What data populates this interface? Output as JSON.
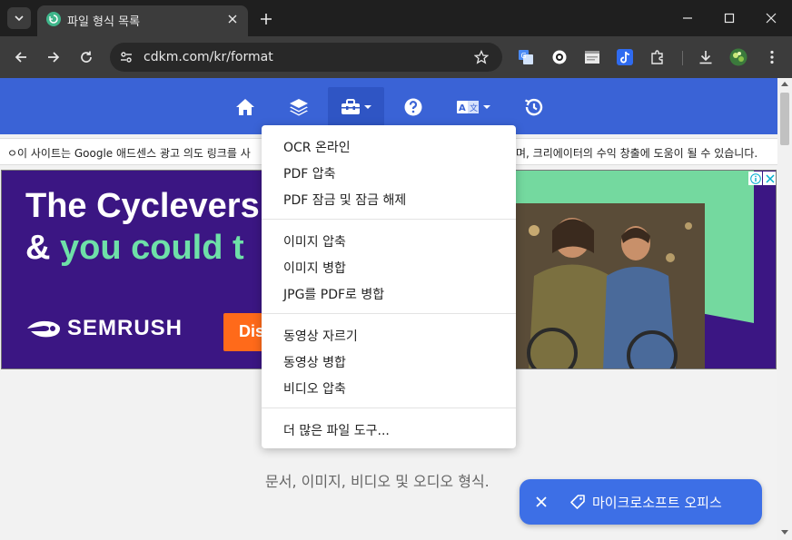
{
  "browser": {
    "tab_title": "파일 형식 목록",
    "url": "cdkm.com/kr/format"
  },
  "site_nav": {
    "items": [
      "home-icon",
      "layers-icon",
      "toolbox-icon",
      "help-icon",
      "translate-icon",
      "history-icon"
    ],
    "active": "toolbox-icon"
  },
  "notice": {
    "left": "ㅇ이 사이트는 Google 애드센스 광고 의도 링크를 사",
    "right": "며, 크리에이터의 수익 창출에 도움이 될 수 있습니다."
  },
  "ad": {
    "headline1": "The Cyclevers",
    "headline2_prefix": "& ",
    "headline2_green": "you could t",
    "logo_text": "SEMRUSH",
    "cta": "Dis"
  },
  "dropdown": {
    "groups": [
      [
        "OCR 온라인",
        "PDF 압축",
        "PDF 잠금 및 잠금 해제"
      ],
      [
        "이미지 압축",
        "이미지 병합",
        "JPG를 PDF로 병합"
      ],
      [
        "동영상 자르기",
        "동영상 병합",
        "비디오 압축"
      ],
      [
        "더 많은 파일 도구..."
      ]
    ]
  },
  "page": {
    "subtitle": "문서, 이미지, 비디오 및 오디오 형식."
  },
  "fab": {
    "label": "마이크로소프트 오피스"
  },
  "colors": {
    "site_nav": "#3a63d6",
    "ad_background": "#3b1683",
    "ad_accent_green": "#6ee0a8",
    "cta_orange": "#ff6a1a",
    "fab_blue": "#3d6fe6"
  }
}
